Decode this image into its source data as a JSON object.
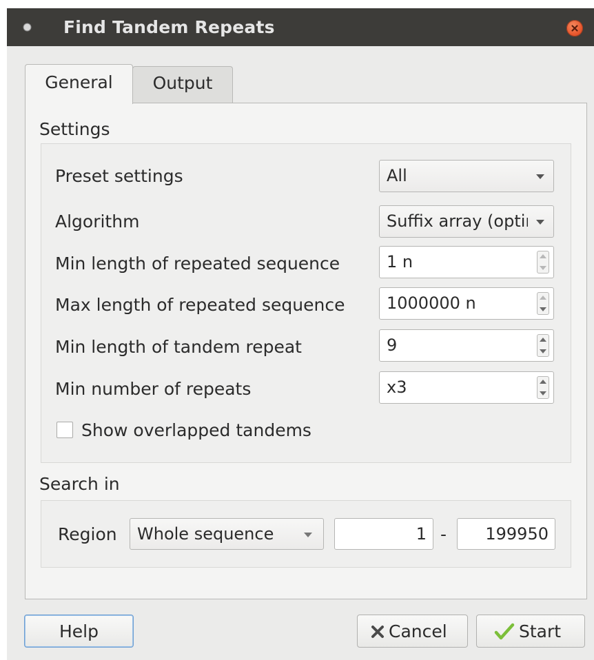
{
  "window": {
    "title": "Find Tandem Repeats"
  },
  "tabs": [
    {
      "label": "General",
      "active": true
    },
    {
      "label": "Output",
      "active": false
    }
  ],
  "settings": {
    "group_title": "Settings",
    "preset": {
      "label": "Preset settings",
      "value": "All"
    },
    "algorithm": {
      "label": "Algorithm",
      "value": "Suffix array (optimized)"
    },
    "min_repeated_len": {
      "label": "Min length of repeated sequence",
      "value": "1 n"
    },
    "max_repeated_len": {
      "label": "Max length of repeated sequence",
      "value": "1000000 n"
    },
    "min_tandem_len": {
      "label": "Min length of tandem repeat",
      "value": "9"
    },
    "min_repeats": {
      "label": "Min number of repeats",
      "value": "x3"
    },
    "show_overlapped": {
      "label": "Show overlapped tandems",
      "checked": false
    }
  },
  "search_in": {
    "group_title": "Search in",
    "region_label": "Region",
    "region_value": "Whole sequence",
    "start": "1",
    "separator": "-",
    "end": "199950"
  },
  "buttons": {
    "help": "Help",
    "cancel": "Cancel",
    "start": "Start"
  },
  "icons": {
    "window_icon": "window-dot-icon",
    "close": "close-icon",
    "cancel": "cancel-x-icon",
    "start": "checkmark-icon"
  },
  "colors": {
    "titlebar": "#3d3c39",
    "close_button": "#e8572d",
    "focus_border": "#6d9ed2",
    "start_check": "#7cbf3a"
  }
}
